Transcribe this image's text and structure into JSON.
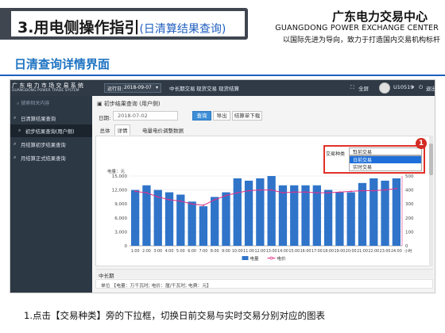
{
  "slide": {
    "title_main": "3.用电侧操作指引",
    "title_sub": "(日清算结果查询)",
    "org_cn": "广东电力交易中心",
    "org_en": "GUANGDONG POWER EXCHANGE CENTER",
    "org_slogan": "以国际先进为导向，致力于打造国内交易机构标杆",
    "section_title": "日清查询详情界面",
    "footnote": "1.点击【交易种类】旁的下拉框，切换日前交易与实时交易分别对应的图表",
    "accent_color": "#1f5fbf"
  },
  "app": {
    "logo_cn": "广 东 电 力 市 场 交 易 系 统",
    "logo_en": "GUANGDONG POWER TRADE SYSTEM",
    "run_date_label": "运行日:",
    "run_date_value": "2018-09-07",
    "top_nav": [
      "中长期交易",
      "现货交易",
      "现货结算"
    ],
    "fullscreen_label": "全屏",
    "user_label": "U10519",
    "logout_label": "退出",
    "sidebar": {
      "search_placeholder": "搜索相关内容",
      "items": [
        {
          "label": "日清算结果查询",
          "icon": "tag-icon"
        },
        {
          "label": "初步结果查询(用户侧)",
          "icon": "tag-icon"
        },
        {
          "label": "月结算初步结果查询",
          "icon": "tag-icon"
        },
        {
          "label": "月结算正式结果查询",
          "icon": "tag-icon"
        }
      ]
    },
    "breadcrumb": "初步结果查询 (用户侧)",
    "date_label": "日期:",
    "date_value": "2018-07-02",
    "buttons": {
      "query": "查询",
      "export": "导出",
      "download": "结算单下载"
    },
    "tabs": [
      "总体",
      "详情",
      "电量电价调整数据"
    ],
    "active_tab": 1,
    "trade_type_label": "交易种类",
    "trade_type_value": "日前交易",
    "trade_type_options": [
      "日前交易",
      "实时交易"
    ],
    "badge_number": "1",
    "mid_section_title": "中长期",
    "units_line": "单位 【电量：万千瓦时; 电价：厘/千瓦时; 电费：元】"
  },
  "chart_data": {
    "type": "bar",
    "categories": [
      "1:00",
      "2:00",
      "3:00",
      "4:00",
      "5:00",
      "6:00",
      "7:00",
      "8:00",
      "9:00",
      "10:00",
      "11:00",
      "12:00",
      "13:00",
      "14:00",
      "15:00",
      "16:00",
      "17:00",
      "18:00",
      "19:00",
      "20:00",
      "21:00",
      "22:00",
      "23:00",
      "24:00"
    ],
    "series": [
      {
        "name": "电量",
        "type": "bar",
        "axis": "left",
        "color": "#2f74c9",
        "values": [
          12000,
          13000,
          12000,
          11500,
          11000,
          9500,
          8500,
          10500,
          11500,
          14500,
          14000,
          14500,
          15000,
          13000,
          13000,
          13000,
          13000,
          12000,
          11500,
          11500,
          13500,
          14500,
          14000,
          14500
        ]
      },
      {
        "name": "电价",
        "type": "line",
        "axis": "right",
        "color": "#e0308a",
        "values": [
          390,
          380,
          350,
          330,
          320,
          300,
          290,
          330,
          360,
          380,
          395,
          400,
          400,
          380,
          385,
          385,
          380,
          380,
          385,
          390,
          395,
          395,
          400,
          410
        ]
      }
    ],
    "ylabel_left": "电量：元",
    "ylim_left": [
      0,
      15000
    ],
    "yticks_left": [
      "0",
      "3,000",
      "6,000",
      "9,000",
      "12,000",
      "15,000"
    ],
    "ylim_right": [
      0,
      500
    ],
    "yticks_right": [
      "0",
      "100",
      "200",
      "300",
      "400",
      "500"
    ],
    "xlabel_unit": "小时",
    "legend": [
      "电量",
      "电价"
    ],
    "grid": true,
    "legend_position": "bottom"
  }
}
